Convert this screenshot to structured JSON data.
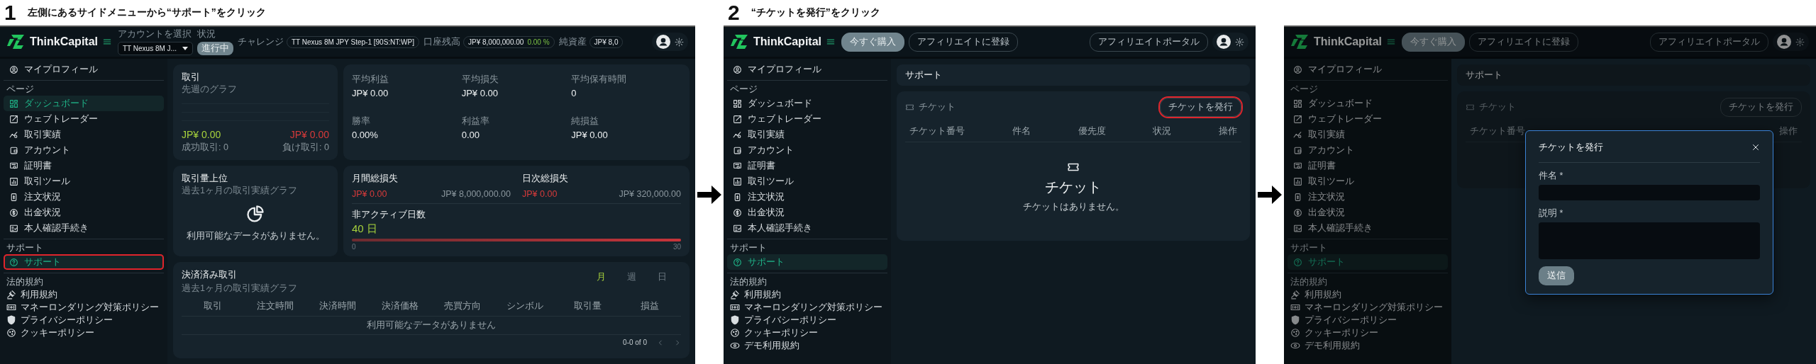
{
  "steps": [
    {
      "number": "1",
      "instruction": "左側にあるサイドメニューから“サポート”をクリック",
      "screen": {
        "topbar": {
          "logo": "ThinkCapital",
          "left": [
            {
              "kind": "select",
              "label": "アカウントを選択",
              "value": "TT Nexus 8M J..."
            },
            {
              "kind": "status",
              "label": "状況",
              "badge": "進行中"
            },
            {
              "kind": "chip",
              "label": "チャレンジ",
              "value": "TT Nexus 8M JPY Step-1 [90S:NT:WP]"
            },
            {
              "kind": "chip",
              "label": "口座残高",
              "value": "JP¥ 8,000,000.00",
              "change": "0.00 %"
            },
            {
              "kind": "chip",
              "label": "純資産",
              "value": "JP¥ 8,0"
            }
          ]
        },
        "sidebar": {
          "profile": "マイプロフィール",
          "groups": [
            {
              "kind": "pages",
              "title": "ページ",
              "items": [
                {
                  "label": "ダッシュボード",
                  "selected": true,
                  "annotated": false
                },
                {
                  "label": "ウェブトレーダー",
                  "selected": false,
                  "annotated": false
                },
                {
                  "label": "取引実績",
                  "selected": false,
                  "annotated": false
                },
                {
                  "label": "アカウント",
                  "selected": false,
                  "annotated": false
                },
                {
                  "label": "証明書",
                  "selected": false,
                  "annotated": false
                },
                {
                  "label": "取引ツール",
                  "selected": false,
                  "annotated": false
                },
                {
                  "label": "注文状況",
                  "selected": false,
                  "annotated": false
                },
                {
                  "label": "出金状況",
                  "selected": false,
                  "annotated": false
                },
                {
                  "label": "本人確認手続き",
                  "selected": false,
                  "annotated": false
                }
              ]
            },
            {
              "kind": "support",
              "title": "サポート",
              "items": [
                {
                  "label": "サポート",
                  "selected": true,
                  "annotated": true
                }
              ]
            },
            {
              "kind": "legal",
              "title": "法的規約",
              "items": [
                "利用規約",
                "マネーロンダリング対策ポリシー",
                "プライバシーポリシー",
                "クッキーポリシー"
              ]
            }
          ]
        },
        "content": {
          "kind": "dashboard",
          "trades": {
            "title": "取引",
            "subtitle": "先週のグラフ",
            "win": {
              "value": "JP¥ 0.00",
              "label": "成功取引: 0"
            },
            "loss": {
              "value": "JP¥ 0.00",
              "label": "負け取引: 0"
            }
          },
          "stats": [
            {
              "label": "平均利益",
              "value": "JP¥ 0.00"
            },
            {
              "label": "平均損失",
              "value": "JP¥ 0.00"
            },
            {
              "label": "平均保有時間",
              "value": "0"
            },
            {
              "label": "勝率",
              "value": "0.00%"
            },
            {
              "label": "利益率",
              "value": "0.00"
            },
            {
              "label": "純損益",
              "value": "JP¥ 0.00"
            }
          ],
          "top_volume": {
            "title": "取引量上位",
            "subtitle": "過去1ヶ月の取引実績グラフ",
            "empty": "利用可能なデータがありません。"
          },
          "losses": [
            {
              "title": "月間総損失",
              "value": "JP¥ 0.00",
              "limit": "JP¥ 8,000,000.00"
            },
            {
              "title": "日次総損失",
              "value": "JP¥ 0.00",
              "limit": "JP¥ 320,000.00"
            }
          ],
          "inactive": {
            "title": "非アクティブ日数",
            "value": "40 日",
            "level": 1,
            "min": "0",
            "max": "30"
          },
          "closed": {
            "title": "決済済み取引",
            "subtitle": "過去1ヶ月の取引実績グラフ",
            "periods": [
              {
                "label": "月",
                "selected": true
              },
              {
                "label": "週",
                "selected": false
              },
              {
                "label": "日",
                "selected": false
              }
            ],
            "columns": [
              "取引",
              "注文時間",
              "決済時間",
              "決済価格",
              "売買方向",
              "シンボル",
              "取引量",
              "損益"
            ],
            "empty": "利用可能なデータがありません",
            "pagination": "0-0 of 0"
          }
        }
      }
    },
    {
      "number": "2",
      "instruction": "“チケットを発行”をクリック",
      "screen": {
        "topbar": {
          "logo": "ThinkCapital",
          "left": [
            {
              "kind": "filled_button",
              "label": "今すぐ購入"
            },
            {
              "kind": "outline_button",
              "label": "アフィリエイトに登録"
            }
          ],
          "right": [
            {
              "kind": "outline_button",
              "label": "アフィリエイトポータル"
            }
          ]
        },
        "sidebar": {
          "profile": "マイプロフィール",
          "groups": [
            {
              "kind": "pages",
              "title": "ページ",
              "items": [
                {
                  "label": "ダッシュボード",
                  "selected": false,
                  "annotated": false
                },
                {
                  "label": "ウェブトレーダー",
                  "selected": false,
                  "annotated": false
                },
                {
                  "label": "取引実績",
                  "selected": false,
                  "annotated": false
                },
                {
                  "label": "アカウント",
                  "selected": false,
                  "annotated": false
                },
                {
                  "label": "証明書",
                  "selected": false,
                  "annotated": false
                },
                {
                  "label": "取引ツール",
                  "selected": false,
                  "annotated": false
                },
                {
                  "label": "注文状況",
                  "selected": false,
                  "annotated": false
                },
                {
                  "label": "出金状況",
                  "selected": false,
                  "annotated": false
                },
                {
                  "label": "本人確認手続き",
                  "selected": false,
                  "annotated": false
                }
              ]
            },
            {
              "kind": "support",
              "title": "サポート",
              "items": [
                {
                  "label": "サポート",
                  "selected": true,
                  "annotated": false
                }
              ]
            },
            {
              "kind": "legal",
              "title": "法的規約",
              "items": [
                "利用規約",
                "マネーロンダリング対策ポリシー",
                "プライバシーポリシー",
                "クッキーポリシー",
                "デモ利用規約"
              ]
            }
          ]
        },
        "content": {
          "kind": "support",
          "title": "サポート",
          "card_title": "チケット",
          "action": {
            "label": "チケットを発行",
            "annotated": true
          },
          "columns": [
            "チケット番号",
            "件名",
            "優先度",
            "状況",
            "操作"
          ],
          "empty_title": "チケット",
          "empty_text": "チケットはありません。"
        }
      }
    },
    {
      "screen": {
        "topbar": {
          "logo": "ThinkCapital",
          "left": [
            {
              "kind": "filled_button",
              "label": "今すぐ購入"
            },
            {
              "kind": "outline_button",
              "label": "アフィリエイトに登録"
            }
          ],
          "right": [
            {
              "kind": "outline_button",
              "label": "アフィリエイトポータル"
            }
          ]
        },
        "sidebar": {
          "profile": "マイプロフィール",
          "groups": [
            {
              "kind": "pages",
              "title": "ページ",
              "items": [
                {
                  "label": "ダッシュボード",
                  "selected": false,
                  "annotated": false
                },
                {
                  "label": "ウェブトレーダー",
                  "selected": false,
                  "annotated": false
                },
                {
                  "label": "取引実績",
                  "selected": false,
                  "annotated": false
                },
                {
                  "label": "アカウント",
                  "selected": false,
                  "annotated": false
                },
                {
                  "label": "証明書",
                  "selected": false,
                  "annotated": false
                },
                {
                  "label": "取引ツール",
                  "selected": false,
                  "annotated": false
                },
                {
                  "label": "注文状況",
                  "selected": false,
                  "annotated": false
                },
                {
                  "label": "出金状況",
                  "selected": false,
                  "annotated": false
                },
                {
                  "label": "本人確認手続き",
                  "selected": false,
                  "annotated": false
                }
              ]
            },
            {
              "kind": "support",
              "title": "サポート",
              "items": [
                {
                  "label": "サポート",
                  "selected": true,
                  "annotated": false
                }
              ]
            },
            {
              "kind": "legal",
              "title": "法的規約",
              "items": [
                "利用規約",
                "マネーロンダリング対策ポリシー",
                "プライバシーポリシー",
                "クッキーポリシー",
                "デモ利用規約"
              ]
            }
          ]
        },
        "content": {
          "kind": "support",
          "title": "サポート",
          "card_title": "チケット",
          "action": {
            "label": "チケットを発行",
            "annotated": false
          },
          "columns": [
            "チケット番号",
            "操作"
          ]
        },
        "modal": {
          "title": "チケットを発行",
          "fields": [
            {
              "kind": "input",
              "label": "件名 *"
            },
            {
              "kind": "textarea",
              "label": "説明 *"
            }
          ],
          "submit": "送信"
        }
      }
    }
  ]
}
